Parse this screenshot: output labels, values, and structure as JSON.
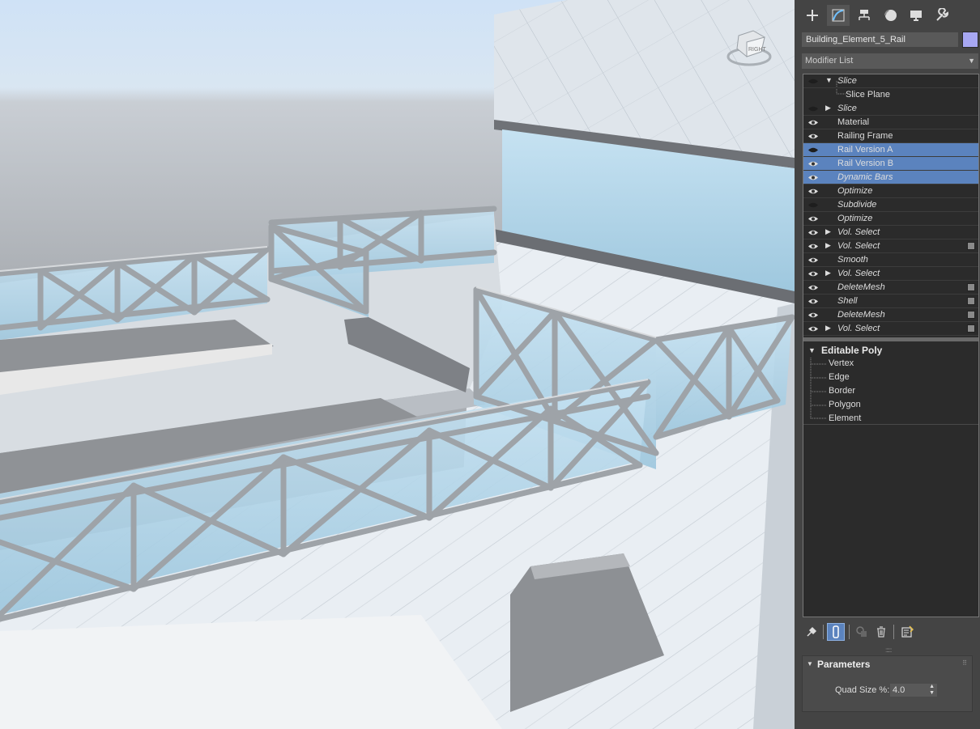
{
  "command_tabs": [
    {
      "name": "create",
      "icon": "plus-icon"
    },
    {
      "name": "modify",
      "icon": "modify-curve-icon",
      "active": true
    },
    {
      "name": "hierarchy",
      "icon": "hierarchy-icon"
    },
    {
      "name": "motion",
      "icon": "motion-circle-icon"
    },
    {
      "name": "display",
      "icon": "display-monitor-icon"
    },
    {
      "name": "utilities",
      "icon": "wrench-icon"
    }
  ],
  "object_name": "Building_Element_5_Rail",
  "object_color": "#a7a7f2",
  "modifier_list_label": "Modifier List",
  "viewcube_label": "RIGHT",
  "modifier_stack": [
    {
      "label": "Slice",
      "italic": true,
      "expand": "open",
      "eye": "off",
      "square": false,
      "selected": false
    },
    {
      "label": "Slice",
      "italic": true,
      "expand": "closed",
      "eye": "off",
      "square": false,
      "selected": false
    },
    {
      "label": "Material",
      "italic": false,
      "expand": "",
      "eye": "on",
      "square": false,
      "selected": false
    },
    {
      "label": "Railing Frame",
      "italic": false,
      "expand": "",
      "eye": "on",
      "square": false,
      "selected": false
    },
    {
      "label": "Rail Version A",
      "italic": false,
      "expand": "",
      "eye": "off",
      "square": false,
      "selected": true
    },
    {
      "label": "Rail Version B",
      "italic": false,
      "expand": "",
      "eye": "on",
      "square": false,
      "selected": true
    },
    {
      "label": "Dynamic Bars",
      "italic": true,
      "expand": "",
      "eye": "on",
      "square": false,
      "selected": true
    },
    {
      "label": "Optimize",
      "italic": true,
      "expand": "",
      "eye": "on",
      "square": false,
      "selected": false
    },
    {
      "label": "Subdivide",
      "italic": true,
      "expand": "",
      "eye": "off",
      "square": false,
      "selected": false
    },
    {
      "label": "Optimize",
      "italic": true,
      "expand": "",
      "eye": "on",
      "square": false,
      "selected": false
    },
    {
      "label": "Vol. Select",
      "italic": true,
      "expand": "closed",
      "eye": "on",
      "square": false,
      "selected": false
    },
    {
      "label": "Vol. Select",
      "italic": true,
      "expand": "closed",
      "eye": "on",
      "square": true,
      "selected": false
    },
    {
      "label": "Smooth",
      "italic": true,
      "expand": "",
      "eye": "on",
      "square": false,
      "selected": false
    },
    {
      "label": "Vol. Select",
      "italic": true,
      "expand": "closed",
      "eye": "on",
      "square": false,
      "selected": false
    },
    {
      "label": "DeleteMesh",
      "italic": true,
      "expand": "",
      "eye": "on",
      "square": true,
      "selected": false
    },
    {
      "label": "Shell",
      "italic": true,
      "expand": "",
      "eye": "on",
      "square": true,
      "selected": false
    },
    {
      "label": "DeleteMesh",
      "italic": true,
      "expand": "",
      "eye": "on",
      "square": true,
      "selected": false
    },
    {
      "label": "Vol. Select",
      "italic": true,
      "expand": "closed",
      "eye": "on",
      "square": true,
      "selected": false
    }
  ],
  "slice_sub": "Slice Plane",
  "base_object": {
    "label": "Editable Poly",
    "subobjects": [
      "Vertex",
      "Edge",
      "Border",
      "Polygon",
      "Element"
    ]
  },
  "stack_toolbar": [
    {
      "name": "pin-stack",
      "icon": "pin-icon"
    },
    {
      "name": "show-end-result",
      "icon": "show-end-result-icon",
      "active": true
    },
    {
      "name": "make-unique",
      "icon": "make-unique-icon"
    },
    {
      "name": "remove-modifier",
      "icon": "trash-icon"
    },
    {
      "name": "configure-modifier-sets",
      "icon": "configure-sets-icon"
    }
  ],
  "parameters": {
    "title": "Parameters",
    "quad_size_label": "Quad Size %:",
    "quad_size_value": "4.0"
  }
}
